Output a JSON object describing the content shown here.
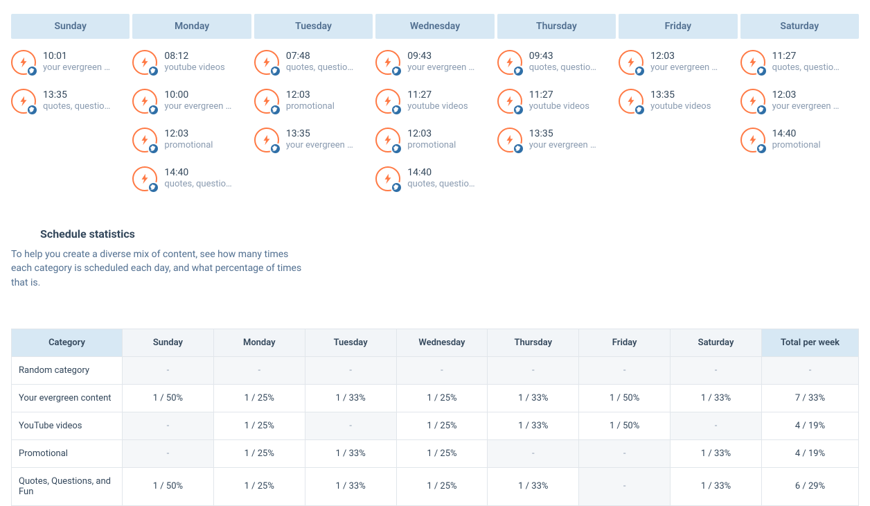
{
  "days": [
    "Sunday",
    "Monday",
    "Tuesday",
    "Wednesday",
    "Thursday",
    "Friday",
    "Saturday"
  ],
  "schedule": {
    "Sunday": [
      {
        "time": "10:01",
        "category": "your evergreen …"
      },
      {
        "time": "13:35",
        "category": "quotes, questio…"
      }
    ],
    "Monday": [
      {
        "time": "08:12",
        "category": "youtube videos"
      },
      {
        "time": "10:00",
        "category": "your evergreen …"
      },
      {
        "time": "12:03",
        "category": "promotional"
      },
      {
        "time": "14:40",
        "category": "quotes, questio…"
      }
    ],
    "Tuesday": [
      {
        "time": "07:48",
        "category": "quotes, questio…"
      },
      {
        "time": "12:03",
        "category": "promotional"
      },
      {
        "time": "13:35",
        "category": "your evergreen …"
      }
    ],
    "Wednesday": [
      {
        "time": "09:43",
        "category": "your evergreen …"
      },
      {
        "time": "11:27",
        "category": "youtube videos"
      },
      {
        "time": "12:03",
        "category": "promotional"
      },
      {
        "time": "14:40",
        "category": "quotes, questio…"
      }
    ],
    "Thursday": [
      {
        "time": "09:43",
        "category": "quotes, questio…"
      },
      {
        "time": "11:27",
        "category": "youtube videos"
      },
      {
        "time": "13:35",
        "category": "your evergreen …"
      }
    ],
    "Friday": [
      {
        "time": "12:03",
        "category": "your evergreen …"
      },
      {
        "time": "13:35",
        "category": "youtube videos"
      }
    ],
    "Saturday": [
      {
        "time": "11:27",
        "category": "quotes, questio…"
      },
      {
        "time": "12:03",
        "category": "your evergreen …"
      },
      {
        "time": "14:40",
        "category": "promotional"
      }
    ]
  },
  "stats_heading": "Schedule statistics",
  "stats_help": "To help you create a diverse mix of content, see how many times each category is scheduled each day, and what percentage of times that is.",
  "table": {
    "headers": [
      "Category",
      "Sunday",
      "Monday",
      "Tuesday",
      "Wednesday",
      "Thursday",
      "Friday",
      "Saturday",
      "Total per week"
    ],
    "rows": [
      {
        "name": "Random category",
        "cells": [
          "-",
          "-",
          "-",
          "-",
          "-",
          "-",
          "-"
        ],
        "total": "-"
      },
      {
        "name": "Your evergreen content",
        "cells": [
          "1 / 50%",
          "1 / 25%",
          "1 / 33%",
          "1 / 25%",
          "1 / 33%",
          "1 / 50%",
          "1 / 33%"
        ],
        "total": "7 / 33%"
      },
      {
        "name": "YouTube videos",
        "cells": [
          "-",
          "1 / 25%",
          "-",
          "1 / 25%",
          "1 / 33%",
          "1 / 50%",
          "-"
        ],
        "total": "4 / 19%"
      },
      {
        "name": "Promotional",
        "cells": [
          "-",
          "1 / 25%",
          "1 / 33%",
          "1 / 25%",
          "-",
          "-",
          "1 / 33%"
        ],
        "total": "4 / 19%"
      },
      {
        "name": "Quotes, Questions, and Fun",
        "cells": [
          "1 / 50%",
          "1 / 25%",
          "1 / 33%",
          "1 / 25%",
          "1 / 33%",
          "-",
          "1 / 33%"
        ],
        "total": "6 / 29%"
      }
    ]
  },
  "icons": {
    "evergreen": "evergreen-icon",
    "network": "twitter-badge-icon"
  },
  "colors": {
    "accent_header": "#d7e8f4",
    "icon_ring": "#ff7a45",
    "badge": "#2f6fa7"
  }
}
